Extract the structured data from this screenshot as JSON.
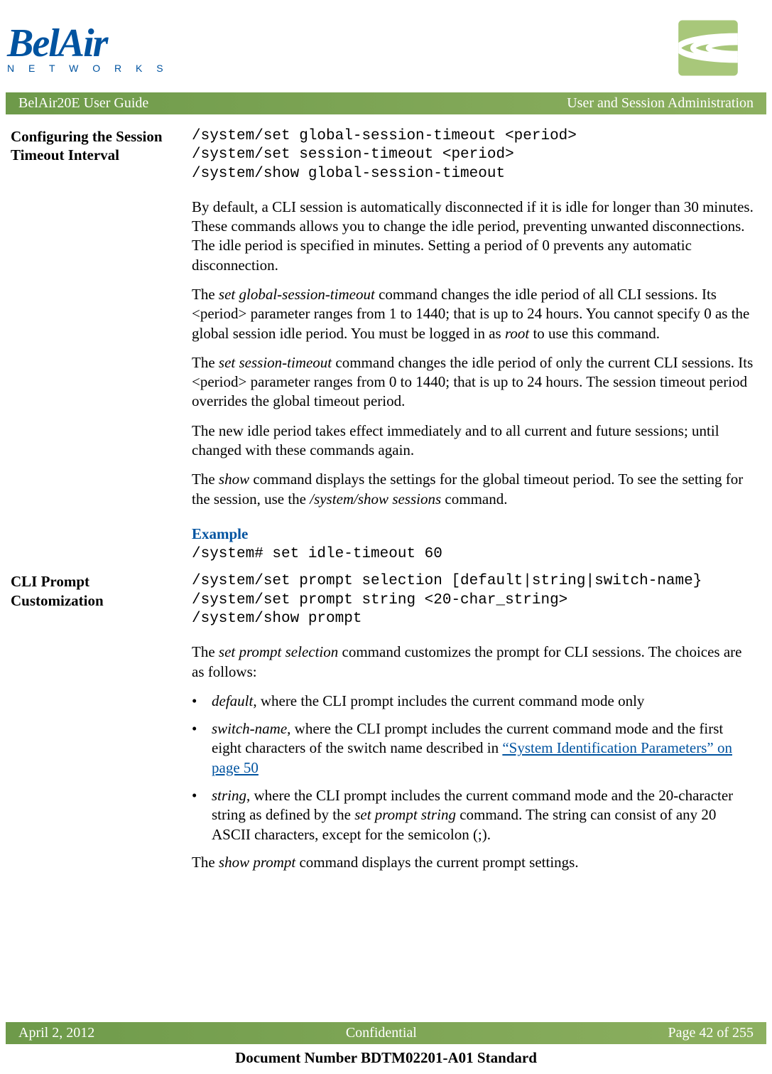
{
  "header": {
    "logo_main": "BelAir",
    "logo_sub": "N E T W O R K S"
  },
  "title_bar": {
    "left": "BelAir20E User Guide",
    "right": "User and Session Administration"
  },
  "section1": {
    "label": "Configuring the Session Timeout Interval",
    "code": "/system/set global-session-timeout <period>\n/system/set session-timeout <period>\n/system/show global-session-timeout",
    "p1": "By default, a CLI session is automatically disconnected if it is idle for longer than 30 minutes. These commands allows you to change the idle period, preventing unwanted disconnections. The idle period is specified in minutes. Setting a period of 0 prevents any automatic disconnection.",
    "p2_a": "The ",
    "p2_cmd1": "set global-session-timeout",
    "p2_b": " command changes the idle period of all CLI sessions. Its <period> parameter ranges from 1 to 1440; that is up to 24 hours. You cannot specify 0 as the global session idle period. You must be logged in as ",
    "p2_cmd2": "root",
    "p2_c": " to use this command.",
    "p3_a": "The ",
    "p3_cmd1": "set session-timeout",
    "p3_b": " command changes the idle period of only the current CLI sessions. Its <period> parameter ranges from 0 to 1440; that is up to 24 hours. The session timeout period overrides the global timeout period.",
    "p4": "The new idle period takes effect immediately and to all current and future sessions; until changed with these commands again.",
    "p5_a": "The ",
    "p5_cmd1": "show",
    "p5_b": " command displays the settings for the global timeout period. To see the setting for the session, use the ",
    "p5_cmd2": "/system/show sessions",
    "p5_c": " command.",
    "example_heading": "Example",
    "example_code": "/system# set idle-timeout 60"
  },
  "section2": {
    "label": "CLI Prompt Customization",
    "code": "/system/set prompt selection [default|string|switch-name}\n/system/set prompt string <20-char_string>\n/system/show prompt",
    "p1_a": "The ",
    "p1_cmd1": "set prompt selection",
    "p1_b": " command customizes the prompt for CLI sessions. The choices are as follows:",
    "b1_cmd": "default",
    "b1_text": ", where the CLI prompt includes the current command mode only",
    "b2_cmd": "switch-name",
    "b2_text": ", where the CLI prompt includes the current command mode and the first eight characters of the switch name described in ",
    "b2_link": "“System Identification Parameters” on page 50",
    "b3_cmd": "string",
    "b3_text_a": ", where the CLI prompt includes the current command mode and the 20-character string as defined by the ",
    "b3_cmd2": "set prompt string",
    "b3_text_b": " command. The string can consist of any 20 ASCII characters, except for the semicolon (;).",
    "p2_a": "The ",
    "p2_cmd1": "show prompt",
    "p2_b": " command displays the current prompt settings."
  },
  "footer": {
    "left": "April 2, 2012",
    "center": "Confidential",
    "right": "Page 42 of 255"
  },
  "doc_number": "Document Number BDTM02201-A01 Standard"
}
